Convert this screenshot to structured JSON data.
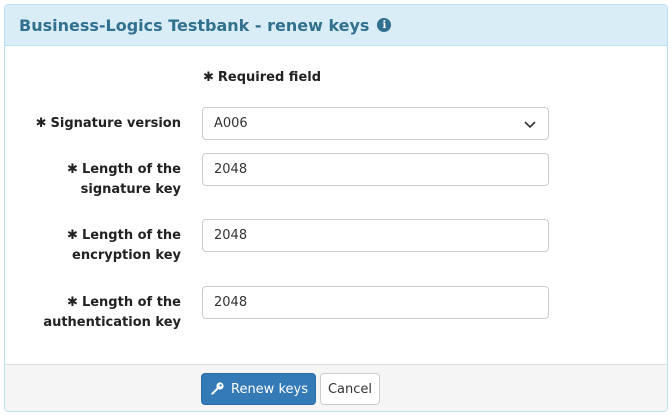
{
  "panel": {
    "title": "Business-Logics Testbank - renew keys",
    "info_icon": "info-icon",
    "info_glyph": "i"
  },
  "form": {
    "required_note": "Required field",
    "required_star": "✱",
    "signature_version": {
      "label": "Signature version",
      "value": "A006"
    },
    "signature_key_length": {
      "label": "Length of the signature key",
      "label_line1": "Length of the",
      "label_line2": "signature key",
      "value": "2048"
    },
    "encryption_key_length": {
      "label": "Length of the encryption key",
      "label_line1": "Length of the",
      "label_line2": "encryption key",
      "value": "2048"
    },
    "authentication_key_length": {
      "label": "Length of the authentication key",
      "label_line1": "Length of the",
      "label_line2": "authentication key",
      "value": "2048"
    }
  },
  "footer": {
    "renew_label": "Renew keys",
    "cancel_label": "Cancel"
  },
  "colors": {
    "heading_bg": "#d9edf7",
    "heading_text": "#31708f",
    "primary": "#337ab7",
    "footer_bg": "#f5f5f5"
  }
}
